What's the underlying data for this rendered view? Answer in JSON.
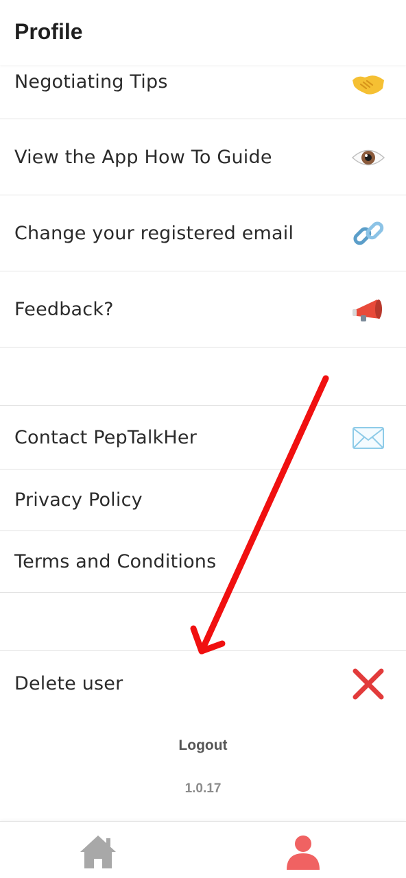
{
  "header": {
    "title": "Profile"
  },
  "menu": {
    "items": [
      {
        "label": "Negotiating Tips",
        "icon": "handshake-icon"
      },
      {
        "label": "View the App How To Guide",
        "icon": "eye-icon"
      },
      {
        "label": "Change your registered email",
        "icon": "link-icon"
      },
      {
        "label": "Feedback?",
        "icon": "megaphone-icon"
      },
      {
        "label": "Contact PepTalkHer",
        "icon": "envelope-icon"
      },
      {
        "label": "Privacy Policy"
      },
      {
        "label": "Terms and Conditions"
      },
      {
        "label": "Delete user",
        "icon": "cross-mark-icon"
      }
    ]
  },
  "footer": {
    "logout": "Logout",
    "version": "1.0.17"
  },
  "bottom_nav": {
    "items": [
      {
        "icon": "home-icon",
        "color": "#a8a8a8"
      },
      {
        "icon": "profile-icon",
        "color": "#f06262",
        "active": true
      }
    ]
  },
  "colors": {
    "accent": "#f06262",
    "annotation_arrow": "#f01010"
  }
}
